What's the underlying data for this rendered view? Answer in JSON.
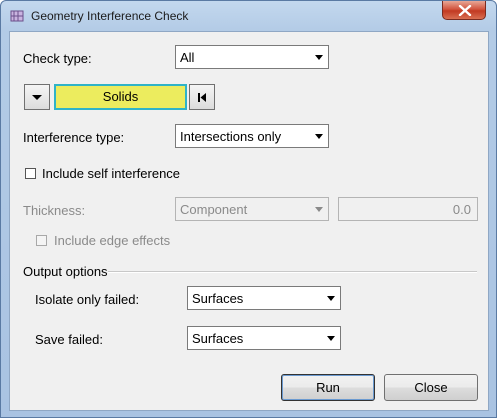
{
  "window": {
    "title": "Geometry Interference Check"
  },
  "check_type": {
    "label": "Check type:",
    "value": "All"
  },
  "selector": {
    "entity_type": "Solids"
  },
  "interference_type": {
    "label": "Interference type:",
    "value": "Intersections only"
  },
  "self_interference": {
    "label": "Include self interference",
    "checked": false
  },
  "thickness": {
    "label": "Thickness:",
    "source": "Component",
    "value": "0.0"
  },
  "edge_effects": {
    "label": "Include edge effects",
    "checked": false,
    "enabled": false
  },
  "output_options": {
    "group_label": "Output options",
    "isolate_label": "Isolate only failed:",
    "isolate_value": "Surfaces",
    "save_label": "Save failed:",
    "save_value": "Surfaces"
  },
  "buttons": {
    "run": "Run",
    "close": "Close"
  }
}
